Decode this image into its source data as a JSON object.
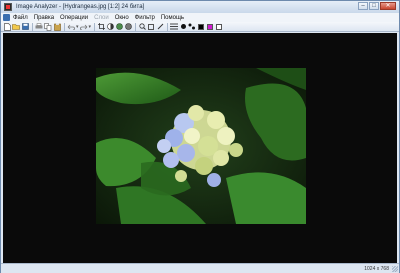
{
  "window": {
    "title": "Image Analyzer - [Hydrangeas.jpg [1:2] 24 бита]",
    "controls": [
      "–",
      "□",
      "✕"
    ]
  },
  "menu": {
    "items": [
      "Файл",
      "Правка",
      "Операции",
      "Слои",
      "Окно",
      "Фильтр",
      "Помощь"
    ]
  },
  "toolbar": {
    "items": [
      "new-icon",
      "open-icon",
      "save-icon",
      "print-icon",
      "copy-icon",
      "paste-icon",
      "undo-icon",
      "redo-icon",
      "crop-icon",
      "contrast-icon",
      "color-icon",
      "grayscale-icon",
      "zoom-icon",
      "select-icon",
      "pen-icon",
      "line-width-icon",
      "brush-icon",
      "shape-icon",
      "color-black",
      "color-magenta",
      "color-white"
    ]
  },
  "status": {
    "resolution": "1024 x 768"
  }
}
